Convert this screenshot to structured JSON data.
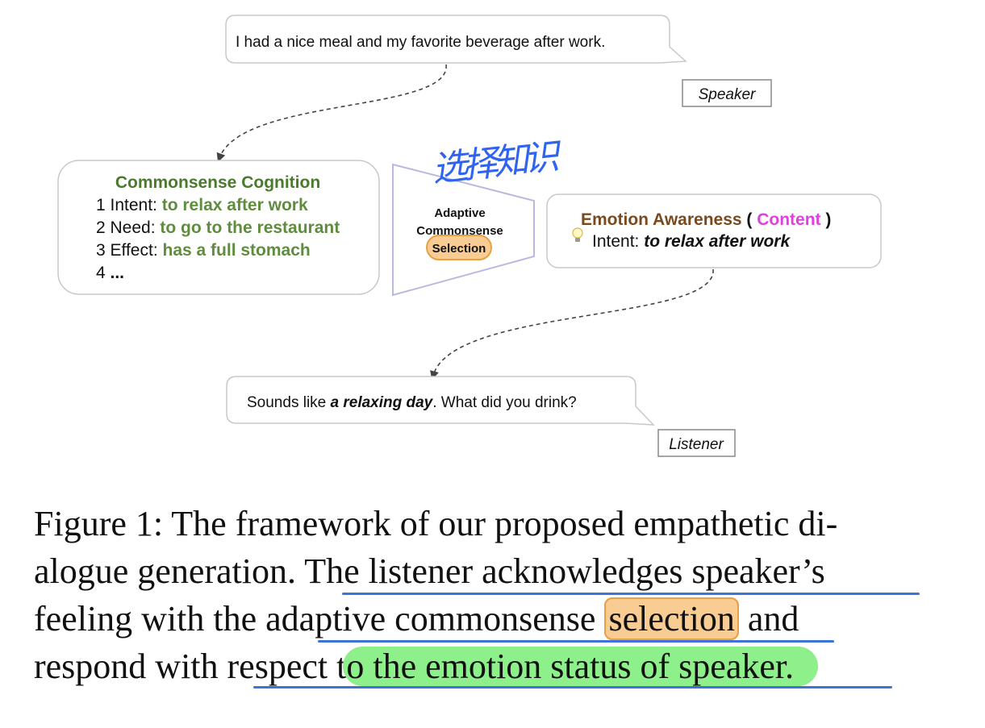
{
  "speaker_bubble": {
    "text": "I had a nice meal and my favorite beverage after work."
  },
  "speaker_label": "Speaker",
  "commonsense": {
    "title": "Commonsense Cognition",
    "items": [
      {
        "prefix": "1 Intent: ",
        "value": "to relax after work"
      },
      {
        "prefix": "2 Need: ",
        "value": "to go to the restaurant"
      },
      {
        "prefix": "3 Effect: ",
        "value": "has a full stomach"
      },
      {
        "prefix": "4 ",
        "value": "..."
      }
    ]
  },
  "selector": {
    "line1": "Adaptive",
    "line2": "Commonsense",
    "badge": "Selection"
  },
  "handwritten_note": "选择知识",
  "emotion": {
    "title": "Emotion Awareness",
    "paren_open": " ( ",
    "content_word": "Content",
    "paren_close": " )",
    "intent_prefix": "Intent: ",
    "intent_value": "to relax after work",
    "bulb_icon": "lightbulb-icon"
  },
  "listener_bubble": {
    "before": "Sounds like ",
    "emph": "a relaxing day",
    "after": ". What did you drink?"
  },
  "listener_label": "Listener",
  "caption": {
    "line1": "Figure 1: The framework of our proposed empathetic di-",
    "line2a": "alogue generation. ",
    "line2b": "The listener acknowledges speaker’s",
    "line3a": "feeling with the a",
    "line3b": "daptive commonsense ",
    "line3c": "selection",
    "line3d": " and",
    "line4a": "respond with ",
    "line4b": "respect t",
    "line4c": "o the emotion status of speaker."
  },
  "colors": {
    "green_text": "#5f8c3e",
    "brown_title": "#7a4a1e",
    "magenta": "#e040e0",
    "funnel": "#b9b9e0",
    "highlight_green": "#8ef08a",
    "highlight_orange": "#f8cc93",
    "underline_blue": "#3d74d9"
  }
}
